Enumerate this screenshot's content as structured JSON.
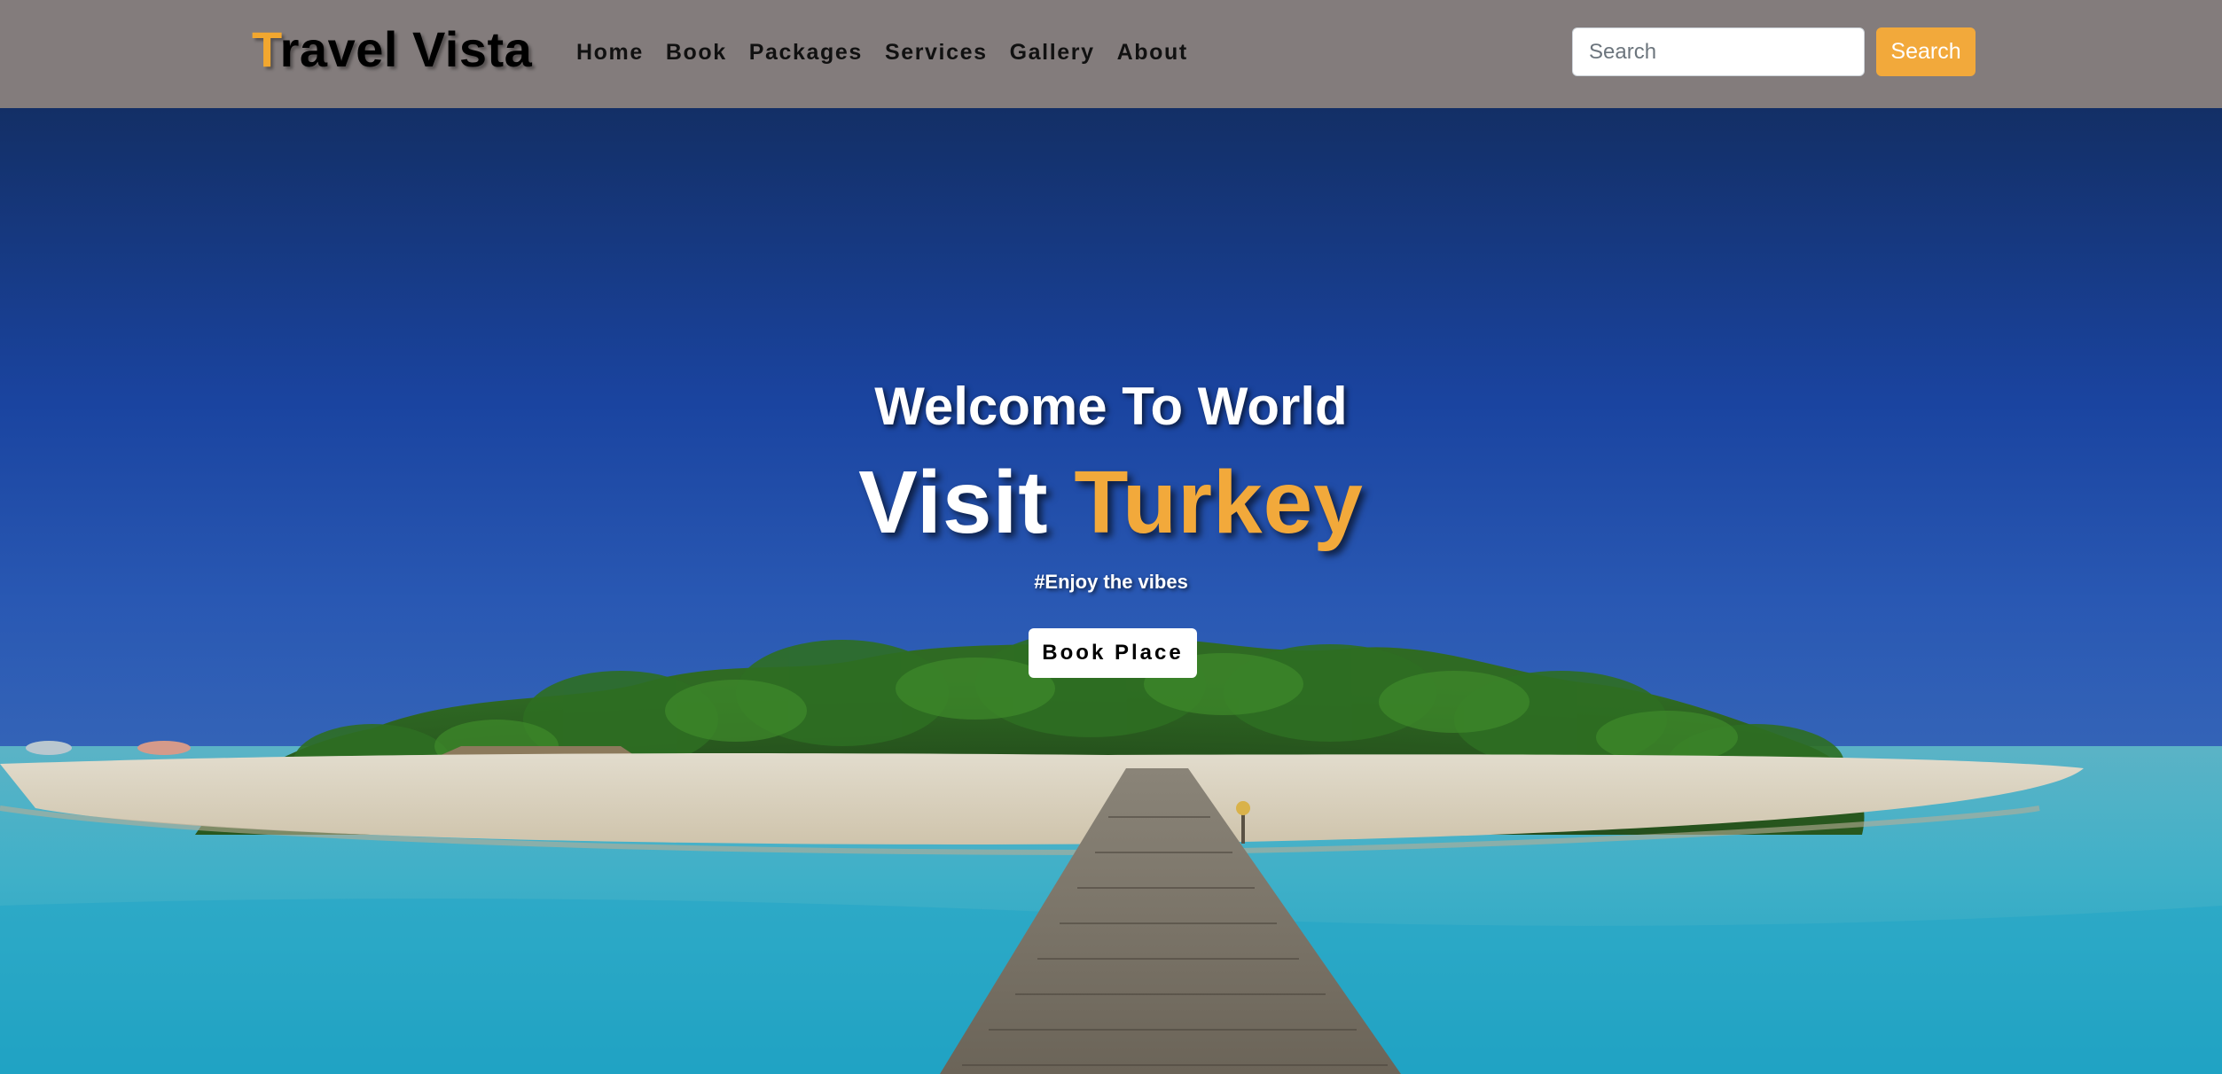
{
  "brand": {
    "first_letter": "T",
    "rest": "ravel Vista"
  },
  "nav": {
    "items": [
      {
        "label": "Home"
      },
      {
        "label": "Book"
      },
      {
        "label": "Packages"
      },
      {
        "label": "Services"
      },
      {
        "label": "Gallery"
      },
      {
        "label": "About"
      }
    ]
  },
  "search": {
    "placeholder": "Search",
    "value": "",
    "button_label": "Search"
  },
  "hero": {
    "welcome": "Welcome To World",
    "visit_prefix": "Visit ",
    "visit_highlight": "Turkey",
    "tagline": "#Enjoy the vibes",
    "cta_label": "Book Place",
    "background_image": "tropical-island-with-pier"
  },
  "colors": {
    "navbar_bg": "#837c7c",
    "accent": "#f2a93b",
    "hero_text": "#ffffff"
  }
}
